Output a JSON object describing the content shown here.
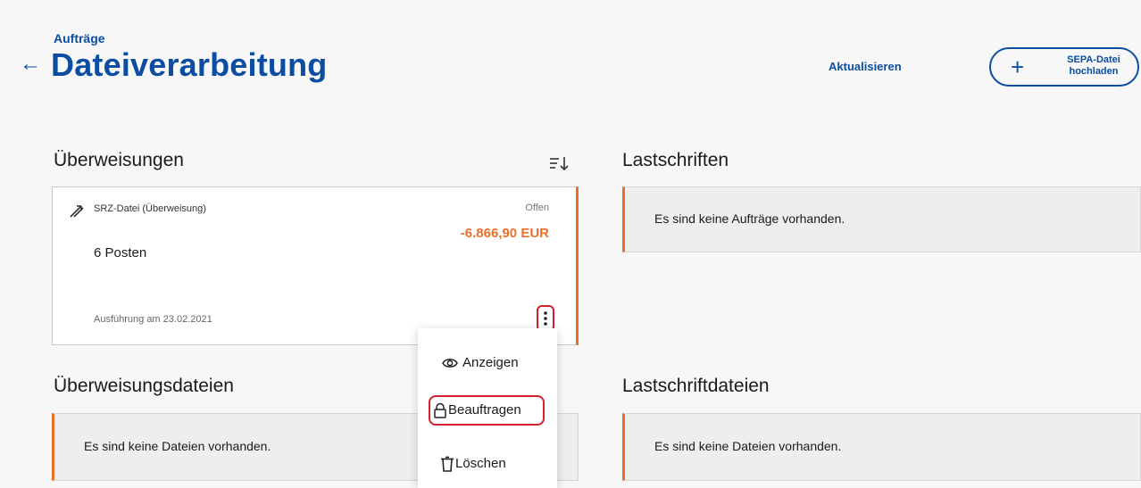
{
  "header": {
    "breadcrumb": "Aufträge",
    "title": "Dateiverarbeitung",
    "refresh_label": "Aktualisieren",
    "upload_label": "SEPA-Datei hochladen"
  },
  "transfers": {
    "heading": "Überweisungen",
    "card": {
      "file_name": "SRZ-Datei (Überweisung)",
      "status": "Offen",
      "amount": "-6.866,90 EUR",
      "count": "6 Posten",
      "execution_date": "Ausführung am 23.02.2021"
    }
  },
  "direct_debits": {
    "heading": "Lastschriften",
    "empty_message": "Es sind keine Aufträge vorhanden."
  },
  "transfer_files": {
    "heading": "Überweisungsdateien",
    "empty_message": "Es sind keine Dateien vorhanden."
  },
  "debit_files": {
    "heading": "Lastschriftdateien",
    "empty_message": "Es sind keine Dateien vorhanden."
  },
  "context_menu": {
    "view_label": "Anzeigen",
    "order_label": "Beauftragen",
    "delete_label": "Löschen"
  },
  "colors": {
    "primary": "#0a4da2",
    "accent": "#e8702a",
    "highlight": "#d4202a"
  }
}
